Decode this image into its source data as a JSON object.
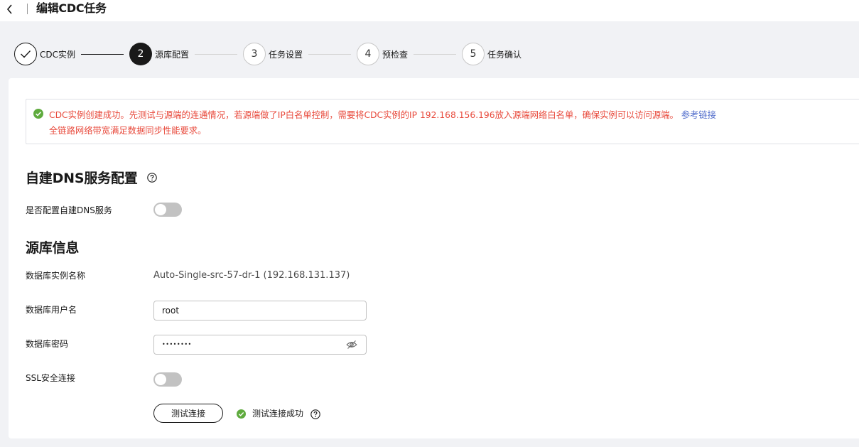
{
  "header": {
    "title": "编辑CDC任务",
    "back_icon": "chevron-left-icon"
  },
  "steps": [
    {
      "number": "1",
      "label": "CDC实例",
      "state": "done"
    },
    {
      "number": "2",
      "label": "源库配置",
      "state": "active"
    },
    {
      "number": "3",
      "label": "任务设置",
      "state": "todo"
    },
    {
      "number": "4",
      "label": "预检查",
      "state": "todo"
    },
    {
      "number": "5",
      "label": "任务确认",
      "state": "todo"
    }
  ],
  "alert": {
    "line1": "CDC实例创建成功。先测试与源端的连通情况，若源端做了IP白名单控制，需要将CDC实例的IP 192.168.156.196放入源端网络白名单，确保实例可以访问源端。",
    "link": "参考链接",
    "line2": "全链路网络带宽满足数据同步性能要求。",
    "color": "#e84a3c",
    "icon_color": "#5fab3e"
  },
  "dns_section": {
    "title": "自建DNS服务配置",
    "toggle_label": "是否配置自建DNS服务",
    "toggle_on": false
  },
  "source_section": {
    "title": "源库信息",
    "instance_label": "数据库实例名称",
    "instance_value": "Auto-Single-src-57-dr-1 (192.168.131.137)",
    "username_label": "数据库用户名",
    "username_value": "root",
    "password_label": "数据库密码",
    "password_masked": "••••••••",
    "ssl_label": "SSL安全连接",
    "ssl_on": false
  },
  "test": {
    "button_label": "测试连接",
    "status_text": "测试连接成功"
  }
}
